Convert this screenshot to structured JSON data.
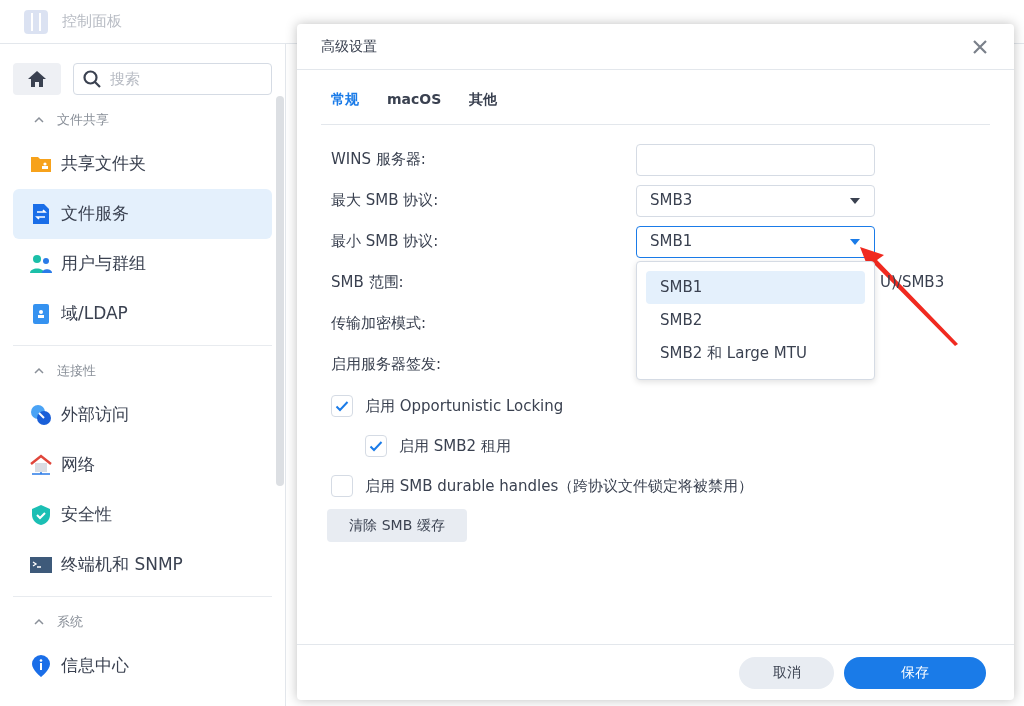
{
  "app": {
    "title": "控制面板"
  },
  "sidebar": {
    "search": {
      "placeholder": "搜索"
    },
    "sections": [
      {
        "title": "文件共享",
        "expanded": true,
        "items": [
          {
            "label": "共享文件夹",
            "kind": "folder",
            "selected": false
          },
          {
            "label": "文件服务",
            "kind": "fileservice",
            "selected": true
          },
          {
            "label": "用户与群组",
            "kind": "users",
            "selected": false
          },
          {
            "label": "域/LDAP",
            "kind": "ldap",
            "selected": false
          }
        ]
      },
      {
        "title": "连接性",
        "expanded": true,
        "items": [
          {
            "label": "外部访问",
            "kind": "link",
            "selected": false
          },
          {
            "label": "网络",
            "kind": "house",
            "selected": false
          },
          {
            "label": "安全性",
            "kind": "shield",
            "selected": false
          },
          {
            "label": "终端机和 SNMP",
            "kind": "terminal",
            "selected": false
          }
        ]
      },
      {
        "title": "系统",
        "expanded": true,
        "items": [
          {
            "label": "信息中心",
            "kind": "info",
            "selected": false
          }
        ]
      }
    ]
  },
  "dialog": {
    "title": "高级设置",
    "tabs": [
      {
        "label": "常规",
        "selected": true
      },
      {
        "label": "macOS",
        "selected": false
      },
      {
        "label": "其他",
        "selected": false
      }
    ],
    "fields": [
      {
        "label": "WINS 服务器:",
        "kind": "text"
      },
      {
        "label": "最大 SMB 协议:",
        "kind": "select",
        "value": "SMB3",
        "expanded": false
      },
      {
        "label": "最小 SMB 协议:",
        "kind": "select",
        "value": "SMB1",
        "expanded": true,
        "options": [
          {
            "label": "SMB1",
            "selected": true
          },
          {
            "label": "SMB2",
            "selected": false
          },
          {
            "label": "SMB2 和 Large MTU",
            "selected": false
          }
        ]
      },
      {
        "label": "SMB 范围:",
        "kind": "static",
        "value": "U)/SMB3"
      },
      {
        "label": "传输加密模式:",
        "kind": "hidden"
      },
      {
        "label": "启用服务器签发:",
        "kind": "hidden"
      }
    ],
    "checkboxes": [
      {
        "label": "启用 Opportunistic Locking",
        "checked": true,
        "children": [
          {
            "label": "启用 SMB2 租用",
            "checked": true
          }
        ]
      },
      {
        "label": "启用 SMB durable handles（跨协议文件锁定将被禁用）",
        "checked": false
      }
    ],
    "action_button": "清除 SMB 缓存",
    "buttons": [
      {
        "label": "取消",
        "kind": "secondary"
      },
      {
        "label": "保存",
        "kind": "primary"
      }
    ]
  }
}
